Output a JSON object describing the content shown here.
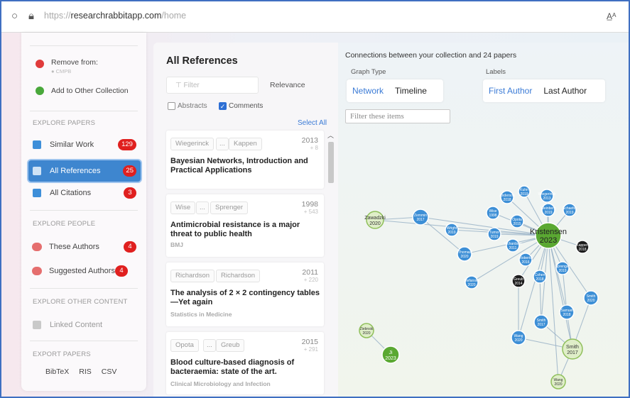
{
  "browser": {
    "url_scheme": "https://",
    "url_host": "researchrabbitapp.com",
    "url_path": "/home"
  },
  "sidebar": {
    "remove_label": "Remove from:",
    "remove_collection": "CMPB",
    "add_label": "Add to Other Collection",
    "explore_papers_heading": "EXPLORE PAPERS",
    "similar_work": {
      "label": "Similar Work",
      "count": "129"
    },
    "all_references": {
      "label": "All References",
      "count": "25"
    },
    "all_citations": {
      "label": "All Citations",
      "count": "3"
    },
    "explore_people_heading": "EXPLORE PEOPLE",
    "these_authors": {
      "label": "These Authors",
      "count": "4"
    },
    "suggested_authors": {
      "label": "Suggested Authors",
      "count": "4"
    },
    "explore_other_heading": "EXPLORE OTHER CONTENT",
    "linked_content": "Linked Content",
    "export_heading": "EXPORT PAPERS",
    "export_bibtex": "BibTeX",
    "export_ris": "RIS",
    "export_csv": "CSV"
  },
  "references": {
    "title": "All References",
    "filter_placeholder": "Filter",
    "sort_label": "Relevance",
    "abstracts_label": "Abstracts",
    "comments_label": "Comments",
    "select_all": "Select All",
    "cards": [
      {
        "author1": "Wiegerinck",
        "author2": "Kappen",
        "ellipsis": "...",
        "year": "2013",
        "cites": "+ 8",
        "title": "Bayesian Networks, Introduction and Practical Applications",
        "journal": ""
      },
      {
        "author1": "Wise",
        "author2": "Sprenger",
        "ellipsis": "...",
        "year": "1998",
        "cites": "+ 543",
        "title": "Antimicrobial resistance is a major threat to public health",
        "journal": "BMJ"
      },
      {
        "author1": "Richardson",
        "author2": "Richardson",
        "ellipsis": "",
        "year": "2011",
        "cites": "+ 220",
        "title": "The analysis of 2 × 2 contingency tables—Yet again",
        "journal": "Statistics in Medicine"
      },
      {
        "author1": "Opota",
        "author2": "Greub",
        "ellipsis": "...",
        "year": "2015",
        "cites": "+ 291",
        "title": "Blood culture-based diagnosis of bacteraemia: state of the art.",
        "journal": "Clinical Microbiology and Infection"
      }
    ]
  },
  "graph": {
    "title": "Connections between your collection and 24 papers",
    "type_label": "Graph Type",
    "type_network": "Network",
    "type_timeline": "Timeline",
    "labels_label": "Labels",
    "labels_first": "First Author",
    "labels_last": "Last Author",
    "filter_placeholder": "Filter these items",
    "colors": {
      "reference": "#3d8fd6",
      "hub": "#5aa832",
      "green_light": "#dfeec8",
      "dark": "#1c1c1c"
    },
    "nodes": [
      {
        "name": "Kristensen",
        "year": "2023",
        "kind": "hub"
      },
      {
        "name": "Zawadzki",
        "year": "2020",
        "kind": "green-light"
      },
      {
        "name": "Zemmin",
        "year": "2017",
        "kind": "blue"
      },
      {
        "name": "Smith",
        "year": "2017",
        "kind": "green-light"
      },
      {
        "name": "Smith",
        "year": "2020",
        "kind": "blue"
      },
      {
        "name": "Smith",
        "year": "2017",
        "kind": "blue"
      },
      {
        "name": "Samuel",
        "year": "2018",
        "kind": "blue"
      },
      {
        "name": "Wang",
        "year": "2020",
        "kind": "blue"
      },
      {
        "name": "Wang",
        "year": "2020",
        "kind": "green-light"
      },
      {
        "name": "Ziebnski",
        "year": "2020",
        "kind": "green-light"
      },
      {
        "name": "Ji",
        "year": "2023",
        "kind": "green"
      },
      {
        "name": "Anderson",
        "year": "2018",
        "kind": "blue"
      },
      {
        "name": "Kuhn",
        "year": "2019",
        "kind": "blue"
      },
      {
        "name": "Wiegerinck",
        "year": "2013",
        "kind": "blue"
      },
      {
        "name": "Schaefer",
        "year": "2019",
        "kind": "blue"
      },
      {
        "name": "Wise",
        "year": "1998",
        "kind": "blue"
      },
      {
        "name": "Opota",
        "year": "2015",
        "kind": "blue"
      },
      {
        "name": "Thomas",
        "year": "2020",
        "kind": "blue"
      },
      {
        "name": "Richardson",
        "year": "2011",
        "kind": "blue"
      },
      {
        "name": "Tumor",
        "year": "2019",
        "kind": "blue"
      },
      {
        "name": "Stefanske",
        "year": "2020",
        "kind": "blue"
      },
      {
        "name": "Wright",
        "year": "2019",
        "kind": "blue"
      },
      {
        "name": "Weinberg",
        "year": "2019",
        "kind": "blue"
      },
      {
        "name": "Cohen",
        "year": "2018",
        "kind": "blue"
      },
      {
        "name": "Greub",
        "year": "2014",
        "kind": "dark"
      },
      {
        "name": "Kappen",
        "year": "2018",
        "kind": "dark"
      },
      {
        "name": "Sprenger",
        "year": "2019",
        "kind": "blue"
      },
      {
        "name": "Roberts",
        "year": "2016",
        "kind": "blue"
      }
    ]
  }
}
